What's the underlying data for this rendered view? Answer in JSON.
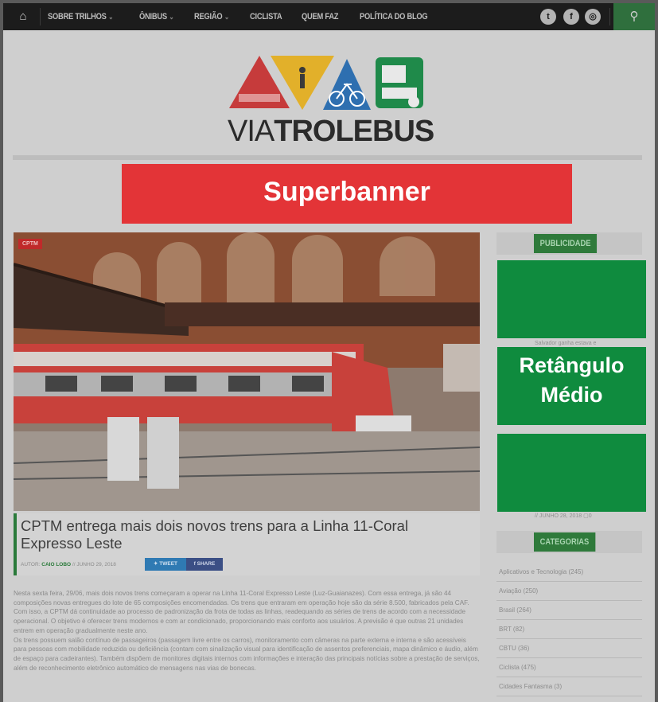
{
  "nav": {
    "items": [
      {
        "label": "SOBRE TRILHOS",
        "has_dropdown": true
      },
      {
        "label": "ÔNIBUS",
        "has_dropdown": true
      },
      {
        "label": "REGIÃO",
        "has_dropdown": true
      },
      {
        "label": "CICLISTA",
        "has_dropdown": false
      },
      {
        "label": "QUEM FAZ",
        "has_dropdown": false
      },
      {
        "label": "POLÍTICA DO BLOG",
        "has_dropdown": false
      }
    ],
    "social": {
      "twitter": "t",
      "facebook": "f",
      "instagram": "◎"
    },
    "search_icon": "search-icon"
  },
  "logo": {
    "text_light": "VIA",
    "text_bold": "TROLEBUS"
  },
  "superbanner": "Superbanner",
  "hero": {
    "tag": "CPTM"
  },
  "post": {
    "title": "CPTM entrega mais dois novos trens para a Linha 11-Coral Expresso Leste",
    "author_prefix": "AUTOR:",
    "author": "CAIO LOBO",
    "date": "// JUNHO 29, 2018",
    "tweet": "TWEET",
    "share": "SHARE",
    "paragraphs": [
      "Nesta sexta feira, 29/06, mais dois novos trens começaram a operar na Linha 11-Coral Expresso Leste (Luz-Guaianazes). Com essa entrega, já são 44 composições novas entregues do lote de 65 composições encomendadas. Os trens que entraram em operação hoje são da série 8.500, fabricados pela CAF.",
      "Com isso, a CPTM dá continuidade ao processo de padronização da frota de todas as linhas, readequando as séries de trens de acordo com a necessidade operacional. O objetivo é oferecer trens modernos e com ar condicionado, proporcionando mais conforto aos usuários. A previsão é que outras 21 unidades entrem em operação gradualmente neste ano.",
      "Os trens possuem salão contínuo de passageiros (passagem livre entre os carros), monitoramento com câmeras na parte externa e interna e são acessíveis para pessoas com mobilidade reduzida ou deficiência (contam com sinalização visual para identificação de assentos preferenciais, mapa dinâmico e áudio, além de espaço para cadeirantes). Também dispõem de monitores digitais internos com informações e interação das principais notícias sobre a prestação de serviços, além de reconhecimento eletrônico automático de mensagens nas vias de bonecas."
    ]
  },
  "sidebar": {
    "publicidade": "PUBLICIDADE",
    "ad_label": "Retângulo Médio",
    "snippet_1": "Salvador ganha estava e",
    "snippet_2": "// JUNHO 28, 2018 ▢0",
    "categorias": "CATEGORIAS",
    "categories": [
      "Aplicativos e Tecnologia (245)",
      "Aviação (250)",
      "Brasil (264)",
      "BRT (82)",
      "CBTU (36)",
      "Ciclista (475)",
      "Cidades Fantasma (3)"
    ]
  },
  "colors": {
    "nav_bg": "#1c1c1c",
    "brand_green": "#2f7a3b",
    "ad_green": "#0f8b3e",
    "banner_red": "#e33437"
  }
}
